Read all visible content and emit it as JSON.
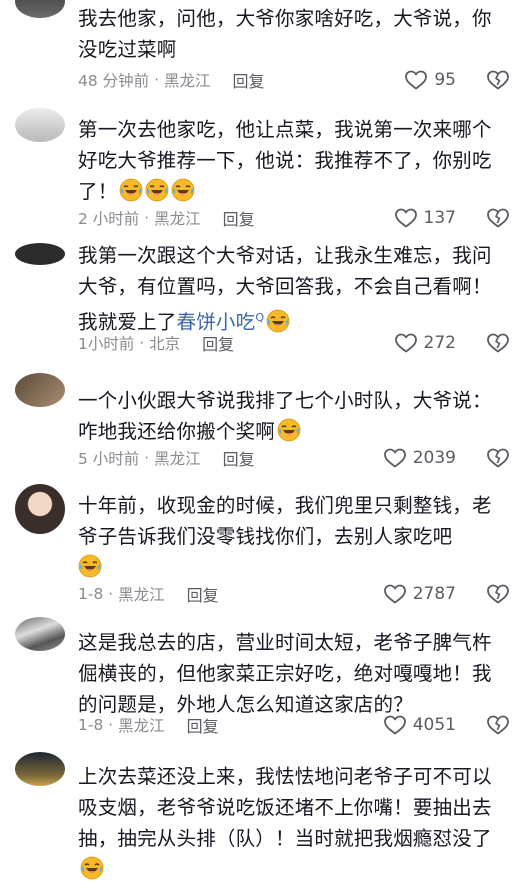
{
  "comments": [
    {
      "text": "我去他家，问他，大爷你家啥好吃，大爷说，你没吃过菜啊",
      "time": "48 分钟前",
      "location": "黑龙江",
      "reply": "回复",
      "likes": "95"
    },
    {
      "text": "第一次去他家吃，他让点菜，我说第一次来哪个好吃大爷推荐一下，他说：我推荐不了，你别吃了！",
      "time": "2 小时前",
      "location": "黑龙江",
      "reply": "回复",
      "likes": "137",
      "emojis": 3
    },
    {
      "text": "我第一次跟这个大爷对话，让我永生难忘，我问大爷，有位置吗，大爷回答我，不会自己看啊！我就爱上了",
      "link": "春饼小吃",
      "time": "1小时前",
      "location": "北京",
      "reply": "回复",
      "likes": "272",
      "emojis": 1
    },
    {
      "text": "一个小伙跟大爷说我排了七个小时队，大爷说：咋地我还给你搬个奖啊",
      "time": "5 小时前",
      "location": "黑龙江",
      "reply": "回复",
      "likes": "2039",
      "emojis": 1
    },
    {
      "text": "十年前，收现金的时候，我们兜里只剩整钱，老爷子告诉我们没零钱找你们，去别人家吃吧",
      "time": "1-8",
      "location": "黑龙江",
      "reply": "回复",
      "likes": "2787",
      "emojis": 1
    },
    {
      "text": "这是我总去的店，营业时间太短，老爷子脾气杵倔横丧的，但他家菜正宗好吃，绝对嘎嘎地！我的问题是，外地人怎么知道这家店的？",
      "time": "1-8",
      "location": "黑龙江",
      "reply": "回复",
      "likes": "4051"
    },
    {
      "text": "上次去菜还没上来，我怯怯地问老爷子可不可以吸支烟，老爷爷说吃饭还堵不上你嘴！要抽出去抽，抽完从头排（队）！当时就把我烟瘾怼没了",
      "emojis": 1
    }
  ],
  "colors": {
    "text": "#161823",
    "meta": "#8a8b91",
    "link": "#3a67a8",
    "emoji": "#f7b928"
  },
  "icons": {
    "like": "heart-outline-icon",
    "dislike": "broken-heart-icon",
    "emoji": "laughing-tears-emoji"
  }
}
